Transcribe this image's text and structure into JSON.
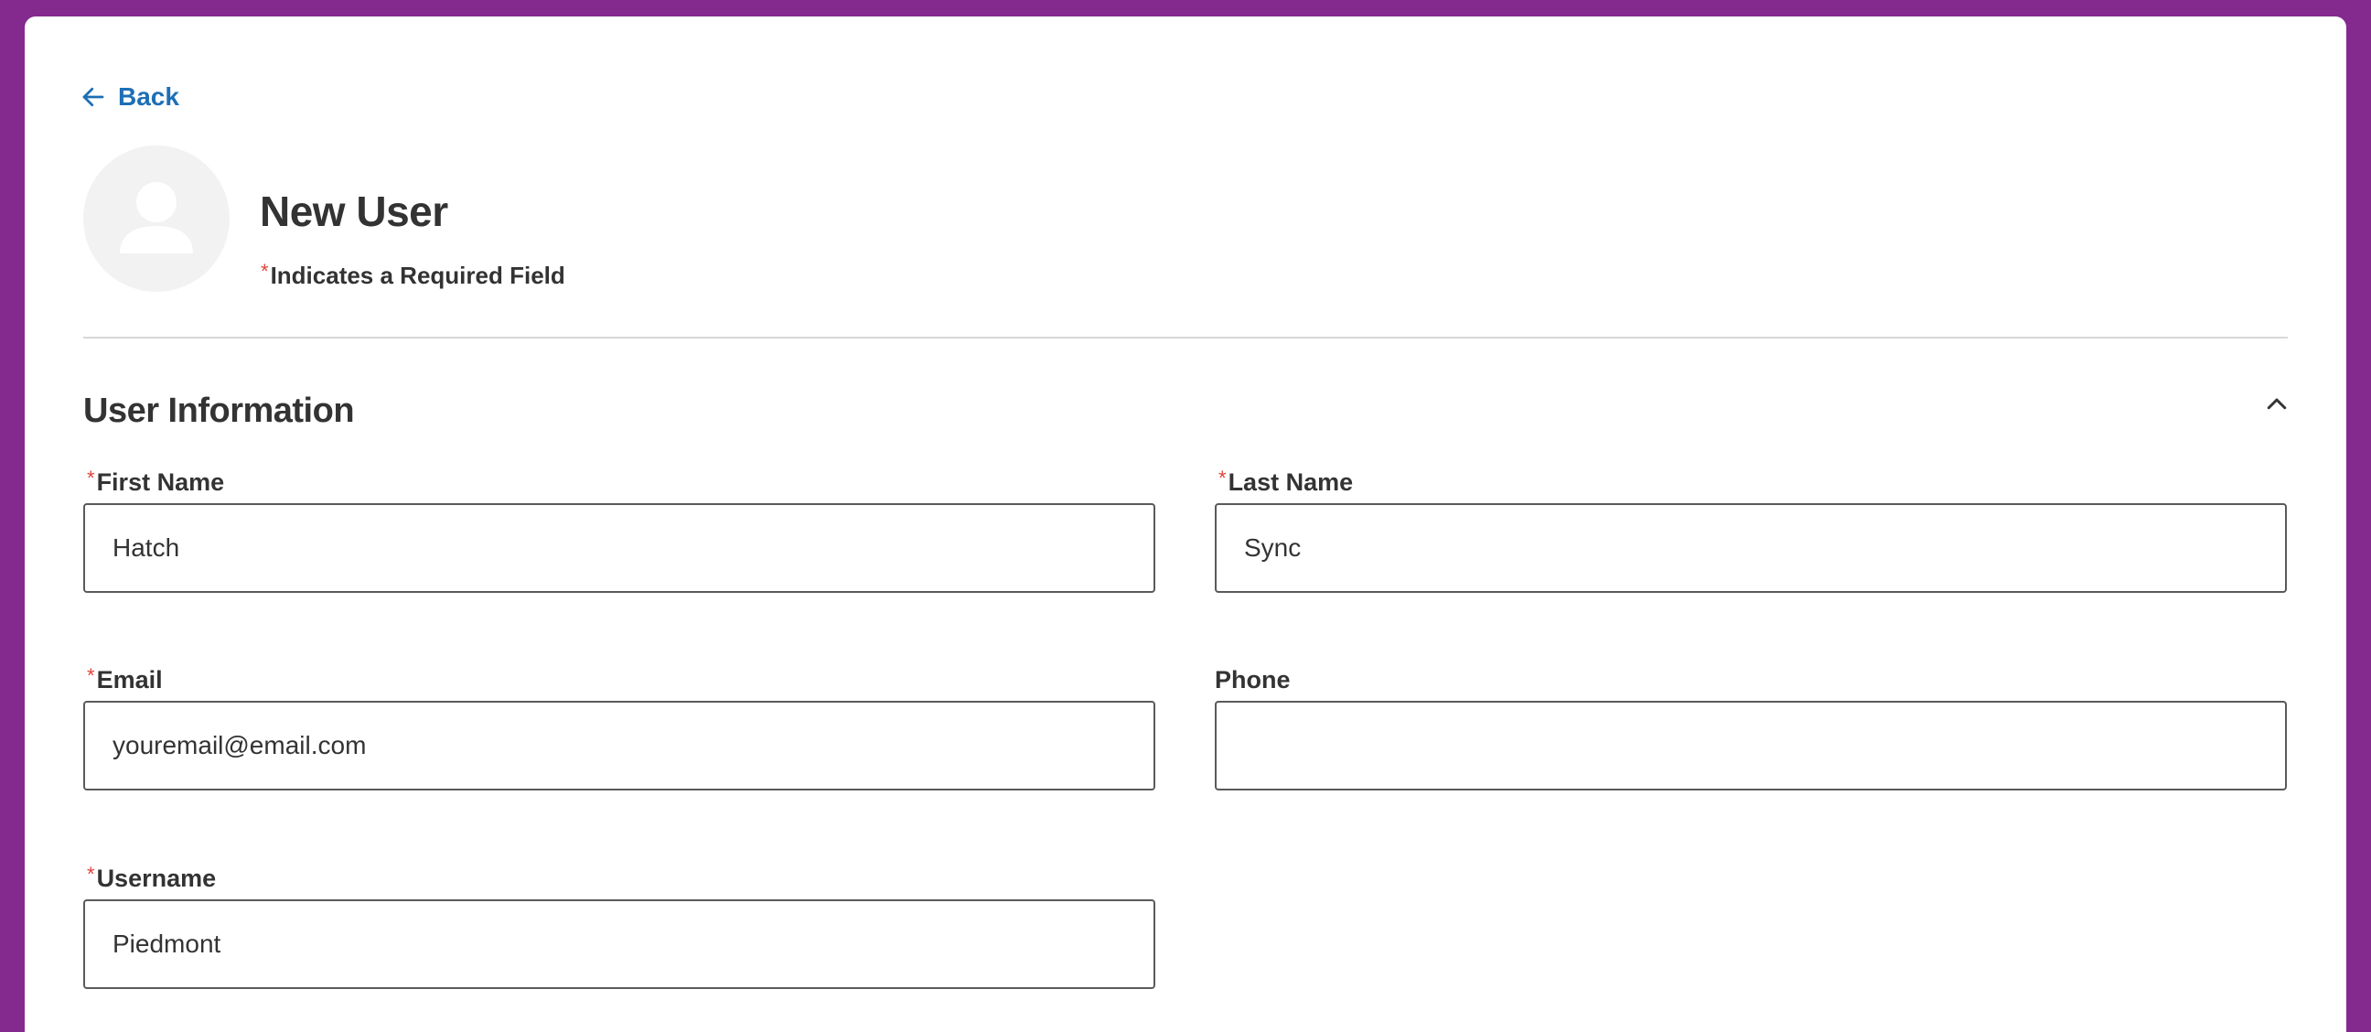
{
  "nav": {
    "back_label": "Back"
  },
  "header": {
    "title": "New User",
    "required_asterisk": "*",
    "required_note": "Indicates a Required Field"
  },
  "section": {
    "title": "User Information",
    "expanded": true
  },
  "fields": {
    "first_name": {
      "label": "First Name",
      "value": "Hatch",
      "required": true
    },
    "last_name": {
      "label": "Last Name",
      "value": "Sync",
      "required": true
    },
    "email": {
      "label": "Email",
      "value": "youremail@email.com",
      "required": true
    },
    "phone": {
      "label": "Phone",
      "value": "",
      "required": false
    },
    "username": {
      "label": "Username",
      "value": "Piedmont",
      "required": true
    }
  },
  "colors": {
    "background": "#84298e",
    "link": "#1d6fb5",
    "required": "#e0443a",
    "text": "#333333"
  },
  "icons": {
    "back": "arrow-left-icon",
    "avatar": "user-silhouette-icon",
    "collapse": "chevron-up-icon"
  }
}
